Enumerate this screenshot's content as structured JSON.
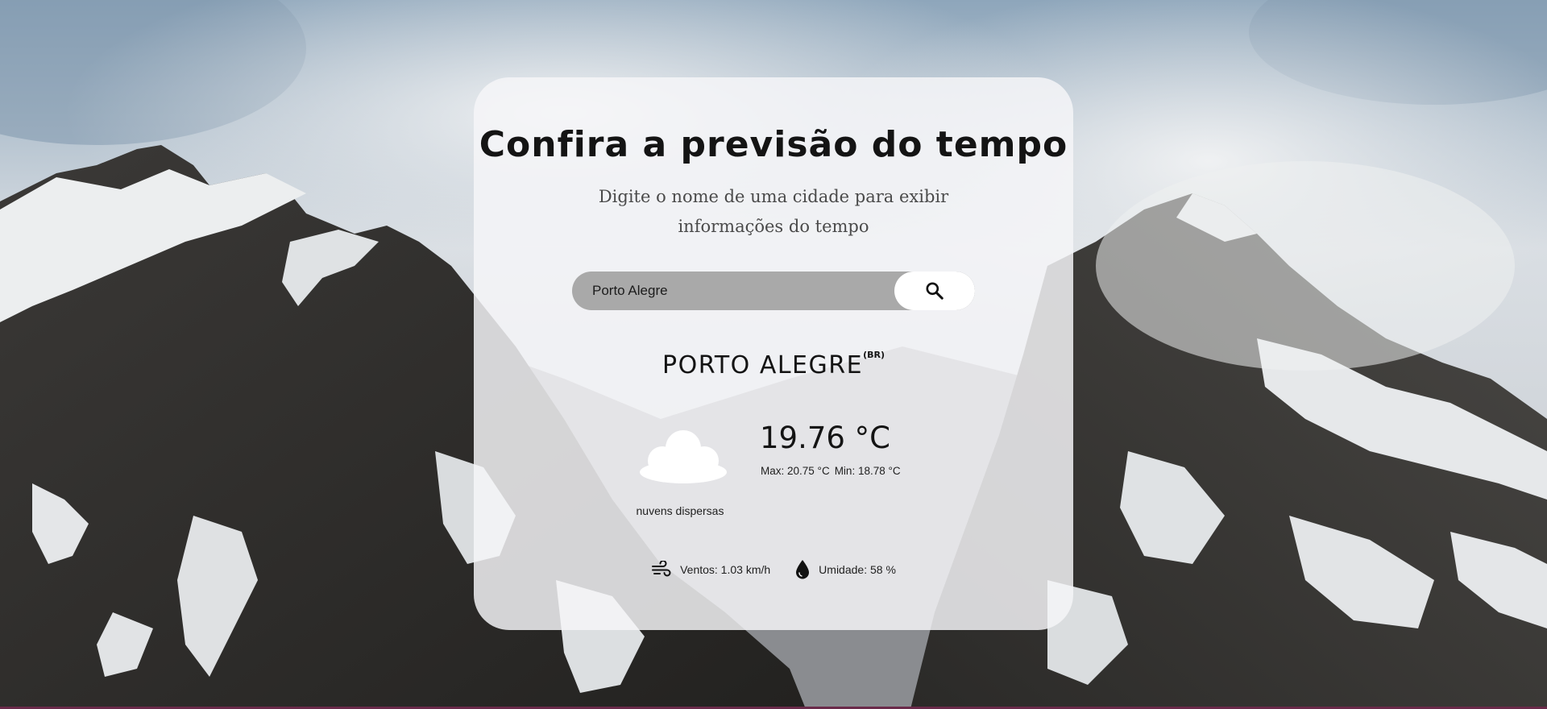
{
  "header": {
    "title": "Confira a previsão do tempo",
    "subtitle": "Digite o nome de uma cidade para exibir informações do tempo"
  },
  "search": {
    "value": "Porto Alegre",
    "icon": "search-icon"
  },
  "weather": {
    "city": "PORTO ALEGRE",
    "country": "(BR)",
    "temperature": "19.76 °C",
    "max": "Max: 20.75 °C",
    "min": "Min: 18.78 °C",
    "description": "nuvens dispersas",
    "condition_icon": "cloud-icon",
    "wind": "Ventos: 1.03 km/h",
    "wind_icon": "wind-icon",
    "humidity": "Umidade: 58 %",
    "humidity_icon": "droplet-icon"
  },
  "colors": {
    "card": "#f5f6f8",
    "search_field": "#a9a9a9",
    "search_button": "#ffffff",
    "text": "#141414",
    "bottom_accent": "#6a2a4a"
  }
}
